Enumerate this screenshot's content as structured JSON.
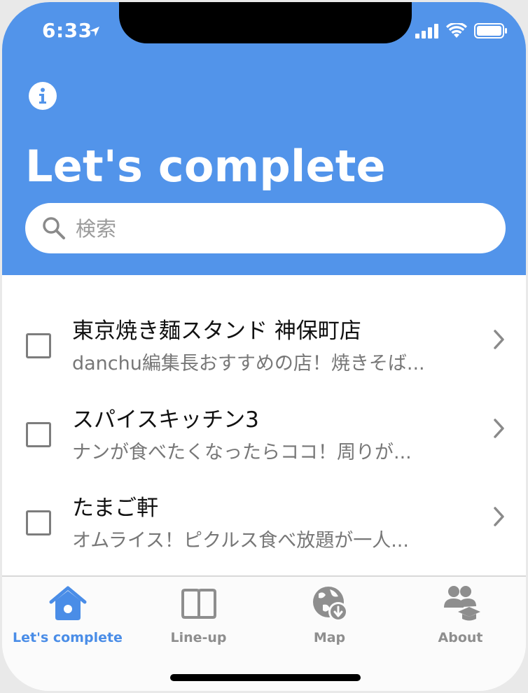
{
  "status_bar": {
    "time": "6:33",
    "location_icon": "location-arrow-icon",
    "signal_icon": "cellular-signal-icon",
    "wifi_icon": "wifi-icon",
    "battery_icon": "battery-icon"
  },
  "header": {
    "info_icon": "info-icon",
    "title": "Let's complete",
    "background_color": "#5294ea"
  },
  "search": {
    "icon": "search-icon",
    "placeholder": "検索",
    "value": ""
  },
  "list": {
    "items": [
      {
        "title": "東京焼き麺スタンド 神保町店",
        "subtitle": "danchu編集長おすすめの店！焼きそば...",
        "checked": false
      },
      {
        "title": "スパイスキッチン3",
        "subtitle": "ナンが食べたくなったらココ！周りが...",
        "checked": false
      },
      {
        "title": "たまご軒",
        "subtitle": "オムライス！ピクルス食べ放題が一人...",
        "checked": false
      }
    ]
  },
  "tabbar": {
    "tabs": [
      {
        "label": "Let's complete",
        "icon": "home-icon",
        "active": true
      },
      {
        "label": "Line-up",
        "icon": "book-icon",
        "active": false
      },
      {
        "label": "Map",
        "icon": "globe-download-icon",
        "active": false
      },
      {
        "label": "About",
        "icon": "people-graduation-icon",
        "active": false
      }
    ],
    "active_color": "#4a8de7",
    "inactive_color": "#8e8e8e"
  }
}
